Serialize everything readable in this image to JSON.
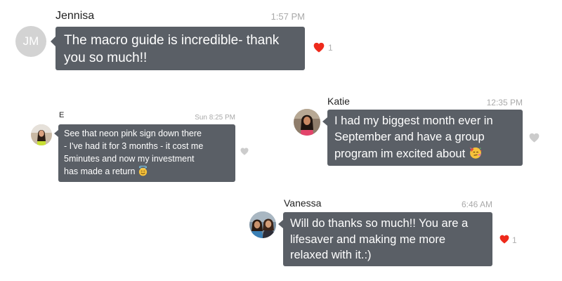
{
  "messages": [
    {
      "sender": "Jennisa",
      "time": "1:57 PM",
      "avatar_initials": "JM",
      "lines": [
        "The macro guide is incredible- thank",
        "you so much!!"
      ],
      "reaction": {
        "icon": "heart-icon",
        "color": "#ee2a1b",
        "count": "1"
      }
    },
    {
      "sender": "E",
      "time": "Sun 8:25 PM",
      "avatar_icon": "profile-photo",
      "lines": [
        "See that neon pink sign down there",
        "- I've had it for 3 months - it cost me",
        "5minutes and now my investment",
        "has made a return"
      ],
      "emoji": "smiling-face-with-halo",
      "reaction": {
        "icon": "heart-outline-icon",
        "color": "#cccccc"
      }
    },
    {
      "sender": "Katie",
      "time": "12:35 PM",
      "avatar_icon": "profile-photo",
      "lines": [
        "I had my biggest month ever in",
        "September and have a group",
        "program im excited about"
      ],
      "emoji": "partying-face",
      "reaction": {
        "icon": "heart-outline-icon",
        "color": "#cccccc"
      }
    },
    {
      "sender": "Vanessa",
      "time": "6:46 AM",
      "avatar_icon": "profile-photo",
      "lines": [
        "Will do thanks so much!! You are a",
        "lifesaver and making me more",
        "relaxed with it.:)"
      ],
      "reaction": {
        "icon": "heart-icon",
        "color": "#ee2a1b",
        "count": "1"
      }
    }
  ],
  "colors": {
    "bubble": "#5a5f66",
    "bubble_text": "#ffffff",
    "timestamp": "#a9a9a9",
    "reaction_active": "#ee2a1b",
    "reaction_inactive": "#cccccc"
  }
}
